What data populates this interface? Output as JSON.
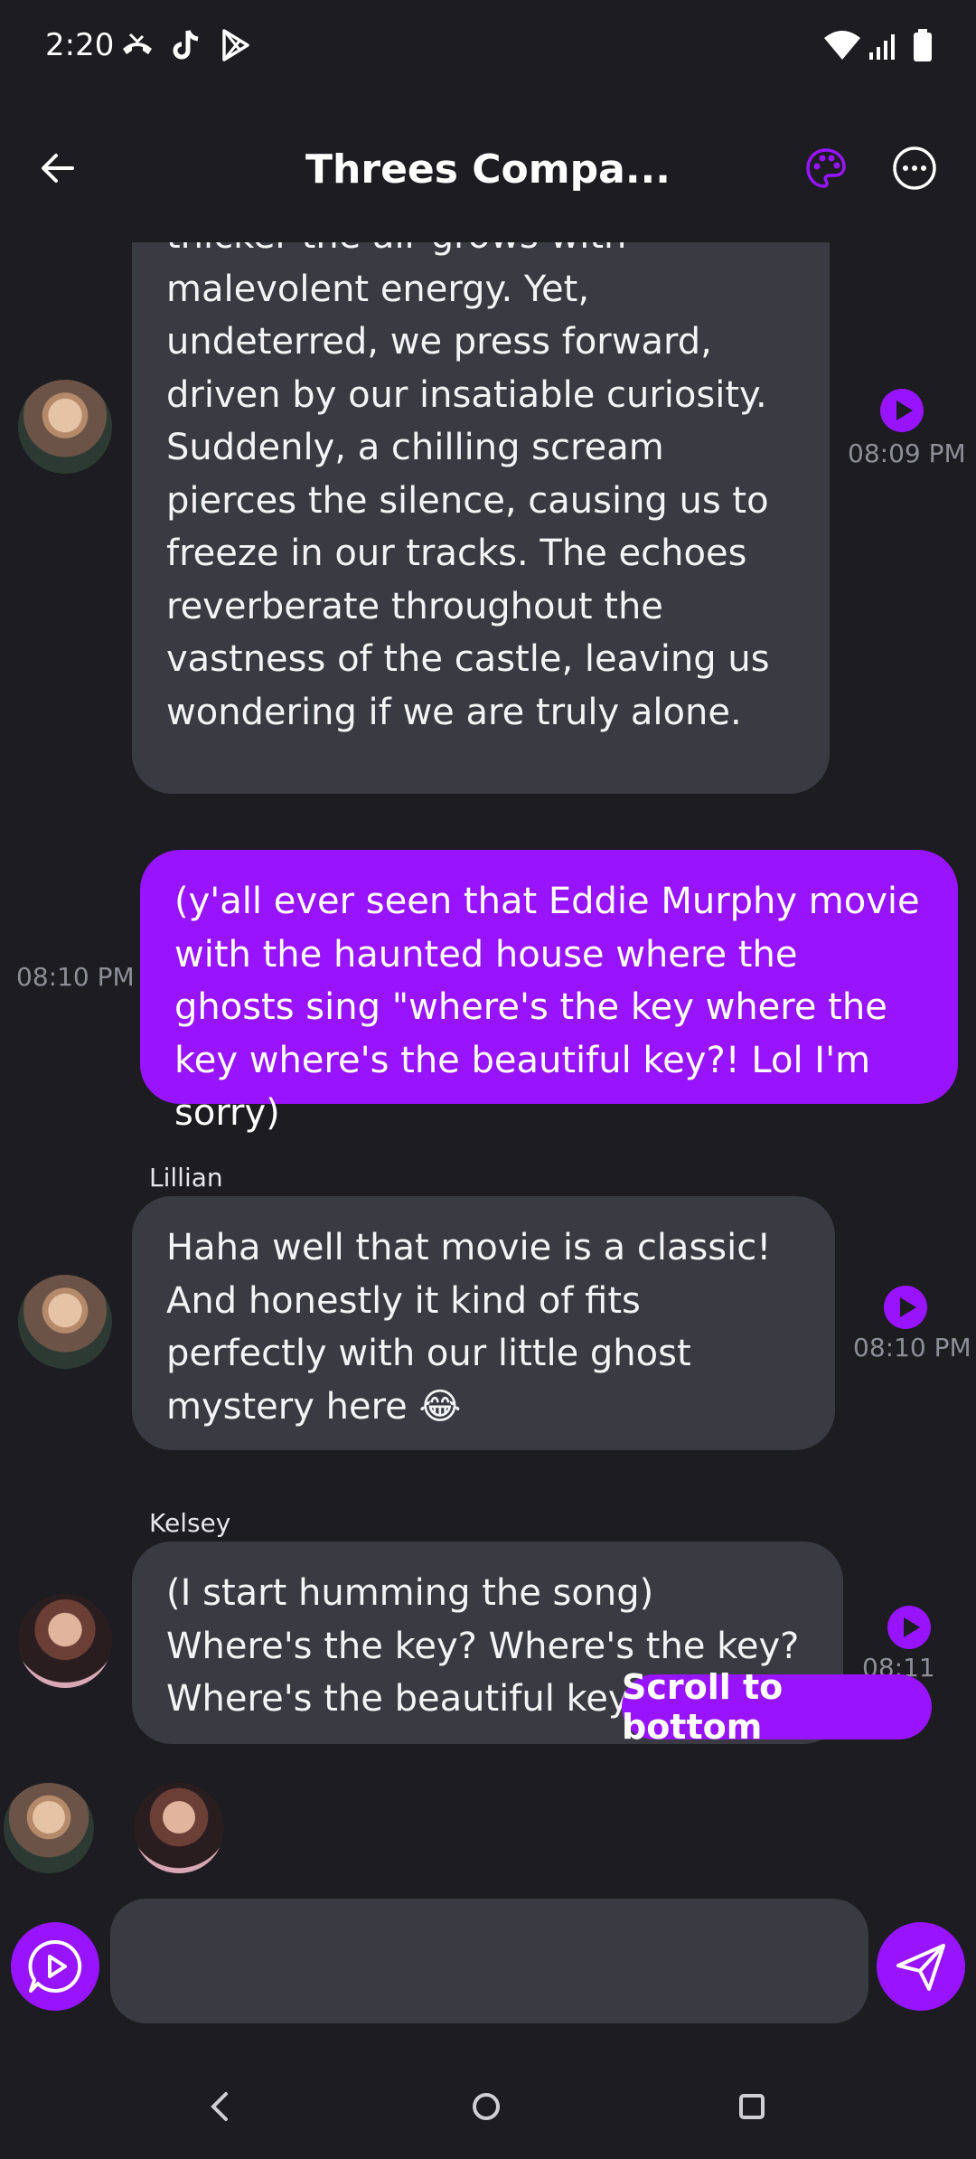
{
  "status_bar": {
    "time": "2:20",
    "icons": [
      "missed-call-icon",
      "tiktok-icon",
      "play-store-icon",
      "wifi-icon",
      "signal-icon",
      "battery-icon"
    ]
  },
  "header": {
    "title": "Threes Compa...",
    "back_icon": "arrow-left-icon",
    "palette_icon": "palette-icon",
    "more_icon": "more-horizontal-icon"
  },
  "messages": [
    {
      "sender": "",
      "side": "left",
      "text": "thicker the air grows with malevolent energy. Yet, undeterred, we press forward, driven by our insatiable curiosity. Suddenly, a chilling scream pierces the silence, causing us to freeze in our tracks. The echoes reverberate throughout the vastness of the castle, leaving us wondering if we are truly alone.",
      "time": "08:09 PM"
    },
    {
      "sender": "",
      "side": "right",
      "text": "(y'all ever seen that Eddie Murphy movie with the haunted house where the ghosts sing \"where's the key where the key where's the beautiful key?! Lol I'm sorry)",
      "time": "08:10 PM"
    },
    {
      "sender": "Lillian",
      "side": "left",
      "text": "Haha well that movie is a classic! And honestly it kind of fits perfectly with our little ghost mystery here 😂",
      "time": "08:10 PM"
    },
    {
      "sender": "Kelsey",
      "side": "left",
      "text": "(I start humming the song) Where's the key? Where's the key? Where's the beautiful key?",
      "time": "08:11 PM"
    }
  ],
  "scroll_button": "Scroll to bottom",
  "input": {
    "placeholder": ""
  },
  "colors": {
    "accent": "#9814ff",
    "bubble": "#3a3b42",
    "background": "#1c1c21"
  }
}
